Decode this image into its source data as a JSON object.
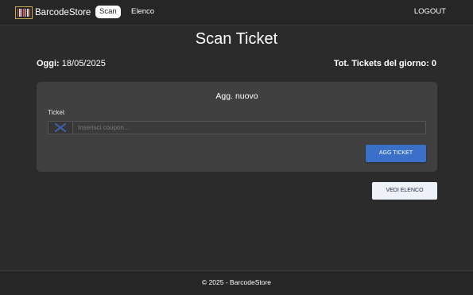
{
  "navbar": {
    "brand": "BarcodeStore",
    "brand_icon": "barcode-icon",
    "items": [
      {
        "label": "Scan",
        "active": true
      },
      {
        "label": "Elenco",
        "active": false
      }
    ],
    "logout": "LOGOUT"
  },
  "page": {
    "title": "Scan Ticket",
    "today_label": "Oggi:",
    "today_value": "18/05/2025",
    "total_label": "Tot. Tickets del giorno:",
    "total_value": "0"
  },
  "form": {
    "title": "Agg. nuovo",
    "field_label": "Ticket",
    "scan_icon": "barcode-scan-icon",
    "input_value": "",
    "input_placeholder": "Inserisci coupon...",
    "submit_label": "AGG TICKET"
  },
  "actions": {
    "vedi_elenco": "VEDI ELENCO"
  },
  "footer": {
    "text": "© 2025 - BarcodeStore"
  },
  "colors": {
    "background": "#2b2b2b",
    "navbar": "#262626",
    "card": "#404040",
    "primary": "#3a70c8",
    "secondary": "#eef1f7"
  }
}
